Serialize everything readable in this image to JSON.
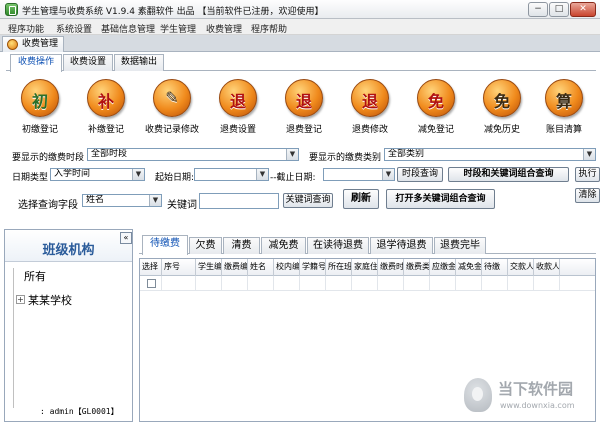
{
  "window": {
    "title": "学生管理与收费系统 V1.9.4 素翻软件 出品 【当前软件已注册，欢迎使用】",
    "min": "−",
    "max": "□",
    "close": "✕"
  },
  "menu": [
    "程序功能",
    "系统设置",
    "基础信息管理",
    "学生管理",
    "收费管理",
    "程序帮助"
  ],
  "doc_tab": "收费管理",
  "sub_tabs": [
    "收费操作",
    "收费设置",
    "数据输出"
  ],
  "tools": [
    {
      "glyph": "初",
      "label": "初缴登记"
    },
    {
      "glyph": "补",
      "label": "补缴登记"
    },
    {
      "glyph": "✎",
      "label": "收费记录修改"
    },
    {
      "glyph": "退",
      "label": "退费设置"
    },
    {
      "glyph": "退",
      "label": "退费登记"
    },
    {
      "glyph": "退",
      "label": "退费修改"
    },
    {
      "glyph": "免",
      "label": "减免登记"
    },
    {
      "glyph": "免",
      "label": "减免历史"
    },
    {
      "glyph": "算",
      "label": "账目清算"
    }
  ],
  "filters": {
    "period_label": "要显示的缴费时段",
    "period_value": "全部时段",
    "category_label": "要显示的缴费类别",
    "category_value": "全部类别",
    "date_type_label": "日期类型",
    "date_type_value": "入学时间",
    "start_label": "起始日期:",
    "start_value": "",
    "end_label": "--截止日期:",
    "end_value": "",
    "period_query": "时段查询",
    "combo_query": "时段和关键词组合查询",
    "execute": "执行",
    "field_label": "选择查询字段",
    "field_value": "姓名",
    "keyword_label": "关键词",
    "keyword_value": "",
    "keyword_query": "关键词查询",
    "refresh": "刷新",
    "multi_query": "打开多关键词组合查询",
    "clear": "清除"
  },
  "left_panel": {
    "title": "班级机构",
    "collapse": "«",
    "tree_root": "所有",
    "tree_child": "某某学校",
    "expander": "+",
    "user_status": ": admin【GL0001】"
  },
  "grid_tabs": [
    "待缴费",
    "欠费",
    "清费",
    "减免费",
    "在读待退费",
    "退学待退费",
    "退费完毕"
  ],
  "grid_columns": [
    "选择",
    "序号",
    "学生编号",
    "缴费编号",
    "姓名",
    "校内编号",
    "学籍号",
    "所在班级",
    "家庭住址",
    "缴费时段",
    "缴费类别",
    "应缴金额",
    "减免金额",
    "待缴",
    "交款人",
    "收款人"
  ],
  "watermark": {
    "text": "当下软件园",
    "url": "www.downxia.com"
  }
}
